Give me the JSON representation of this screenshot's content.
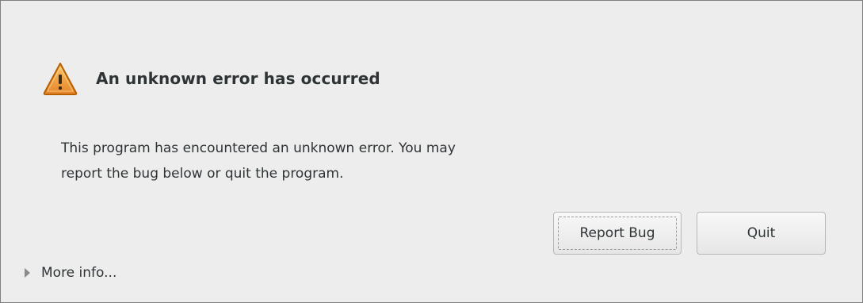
{
  "dialog": {
    "title": "An unknown error has occurred",
    "message_line1": "This program has encountered an unknown error. You may",
    "message_line2": "report the bug below or quit the program.",
    "icon": "warning-icon"
  },
  "buttons": {
    "report_bug_label": "Report Bug",
    "quit_label": "Quit"
  },
  "expander": {
    "label": "More info...",
    "icon": "expander-triangle-icon",
    "expanded": false
  },
  "colors": {
    "background": "#ededed",
    "text": "#2e3436",
    "warning_fill": "#f0a030",
    "warning_stroke": "#c46a00"
  }
}
